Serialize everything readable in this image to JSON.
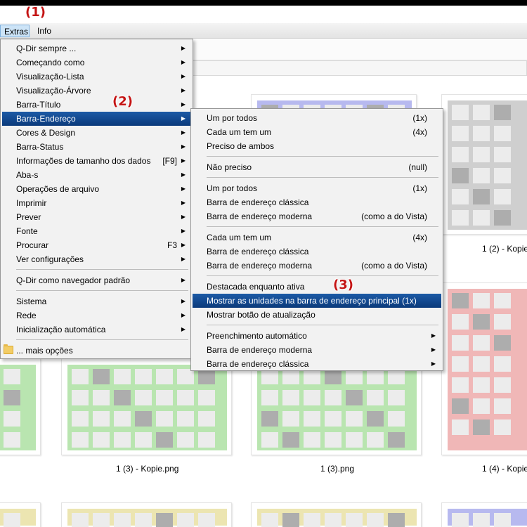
{
  "annotations": [
    "(1)",
    "(2)",
    "(3)"
  ],
  "menubar": {
    "items": [
      "Extras",
      "Info"
    ]
  },
  "extras_menu": {
    "items": [
      {
        "label": "Q-Dir sempre ...",
        "accel": "",
        "submenu": true
      },
      {
        "label": "Começando como",
        "accel": "",
        "submenu": true
      },
      {
        "label": "Visualização-Lista",
        "accel": "",
        "submenu": true
      },
      {
        "label": "Visualização-Árvore",
        "accel": "",
        "submenu": true
      },
      {
        "label": "Barra-Título",
        "accel": "",
        "submenu": true
      },
      {
        "label": "Barra-Endereço",
        "accel": "",
        "submenu": true
      },
      {
        "label": "Cores & Design",
        "accel": "",
        "submenu": true
      },
      {
        "label": "Barra-Status",
        "accel": "",
        "submenu": true
      },
      {
        "label": "Informações de tamanho dos dados",
        "accel": "[F9]",
        "submenu": true
      },
      {
        "label": "Aba-s",
        "accel": "",
        "submenu": true
      },
      {
        "label": "Operações de arquivo",
        "accel": "",
        "submenu": true
      },
      {
        "label": "Imprimir",
        "accel": "",
        "submenu": true
      },
      {
        "label": "Prever",
        "accel": "",
        "submenu": true
      },
      {
        "label": "Fonte",
        "accel": "",
        "submenu": true
      },
      {
        "label": "Procurar",
        "accel": "F3",
        "submenu": true
      },
      {
        "label": "Ver configurações",
        "accel": "",
        "submenu": true
      },
      {
        "label": "Q-Dir como navegador padrão",
        "accel": "",
        "submenu": true
      },
      {
        "label": "Sistema",
        "accel": "",
        "submenu": true
      },
      {
        "label": "Rede",
        "accel": "",
        "submenu": true
      },
      {
        "label": "Inicialização automática",
        "accel": "",
        "submenu": true
      },
      {
        "label": "... mais opções",
        "accel": "",
        "submenu": false
      }
    ]
  },
  "address_submenu": {
    "items": [
      {
        "label": "Um por todos",
        "accel": "(1x)",
        "submenu": false
      },
      {
        "label": "Cada um tem um",
        "accel": "(4x)",
        "submenu": false
      },
      {
        "label": "Preciso de ambos",
        "accel": "",
        "submenu": false
      },
      {
        "label": "Não preciso",
        "accel": "(null)",
        "submenu": false
      },
      {
        "label": "Um por todos",
        "accel": "(1x)",
        "submenu": false
      },
      {
        "label": "Barra de endereço clássica",
        "accel": "",
        "submenu": false
      },
      {
        "label": "Barra de endereço moderna",
        "accel": "(como a do Vista)",
        "submenu": false
      },
      {
        "label": "Cada um tem um",
        "accel": "(4x)",
        "submenu": false
      },
      {
        "label": "Barra de endereço clássica",
        "accel": "",
        "submenu": false
      },
      {
        "label": "Barra de endereço moderna",
        "accel": "(como a do Vista)",
        "submenu": false
      },
      {
        "label": "Destacada enquanto ativa",
        "accel": "",
        "submenu": false
      },
      {
        "label": "Mostrar as unidades na barra de endereço principal (1x)",
        "accel": "",
        "submenu": false
      },
      {
        "label": "Mostrar botão de atualização",
        "accel": "",
        "submenu": false
      },
      {
        "label": "Preenchimento automático",
        "accel": "",
        "submenu": true
      },
      {
        "label": "Barra de endereço moderna",
        "accel": "",
        "submenu": true
      },
      {
        "label": "Barra de endereço clássica",
        "accel": "",
        "submenu": true
      }
    ]
  },
  "files": {
    "captions": [
      "1 (2) - Kopie",
      "1 (3) - Kopie.png",
      "1 (3).png",
      "1 (4) - Kopie"
    ],
    "colors": {
      "green": "#b9e5b0",
      "blue": "#b7b9ef",
      "gray": "#cfcfcf",
      "red": "#f0b7b7",
      "yellow": "#ece5b1",
      "dark": "#adadad",
      "light": "#ececec"
    }
  }
}
